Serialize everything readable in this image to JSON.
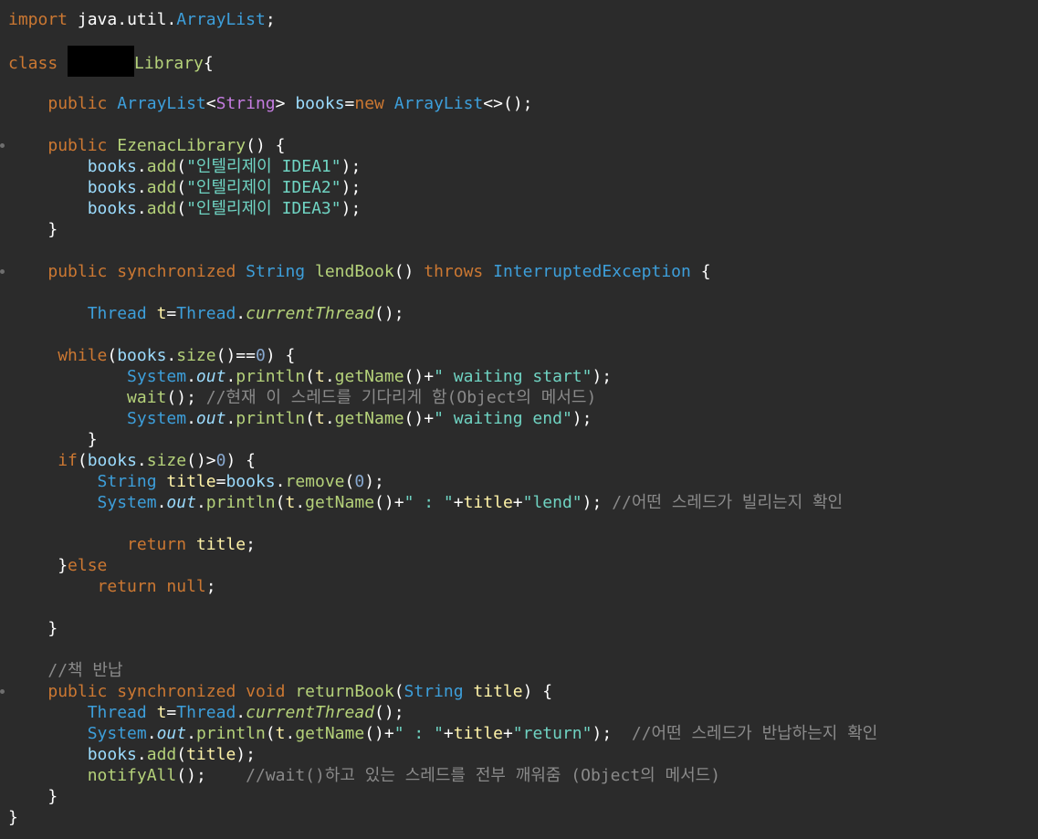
{
  "editor": {
    "language": "java",
    "theme": {
      "background": "#2b2b2b",
      "keyword": "#cc7832",
      "type": "#3d9fdb",
      "generic": "#c47ce0",
      "variable": "#9cdcfe",
      "local": "#fff3a8",
      "method": "#b5d27a",
      "string": "#6fd3c2",
      "number": "#88a8cf",
      "comment": "#8a8a8a"
    },
    "lines": [
      "import java.util.ArrayList;",
      "",
      "class [redacted]Library{",
      "",
      "    public ArrayList<String> books=new ArrayList<>();",
      "",
      "    public EzenacLibrary() {",
      "        books.add(\"인텔리제이 IDEA1\");",
      "        books.add(\"인텔리제이 IDEA2\");",
      "        books.add(\"인텔리제이 IDEA3\");",
      "    }",
      "",
      "    public synchronized String lendBook() throws InterruptedException {",
      "",
      "        Thread t=Thread.currentThread();",
      "",
      "     while(books.size()==0) {",
      "            System.out.println(t.getName()+\" waiting start\");",
      "            wait(); //현재 이 스레드를 기다리게 함(Object의 메서드)",
      "            System.out.println(t.getName()+\" waiting end\");",
      "        }",
      "     if(books.size()>0) {",
      "         String title=books.remove(0);",
      "         System.out.println(t.getName()+\" : \"+title+\"lend\"); //어떤 스레드가 빌리는지 확인",
      "",
      "            return title;",
      "     }else",
      "         return null;",
      "",
      "    }",
      "",
      "    //책 반납",
      "    public synchronized void returnBook(String title) {",
      "        Thread t=Thread.currentThread();",
      "        System.out.println(t.getName()+\" : \"+title+\"return\");  //어떤 스레드가 반납하는지 확인",
      "        books.add(title);",
      "        notifyAll();    //wait()하고 있는 스레드를 전부 깨워줌 (Object의 메서드)",
      "    }",
      "}"
    ]
  }
}
